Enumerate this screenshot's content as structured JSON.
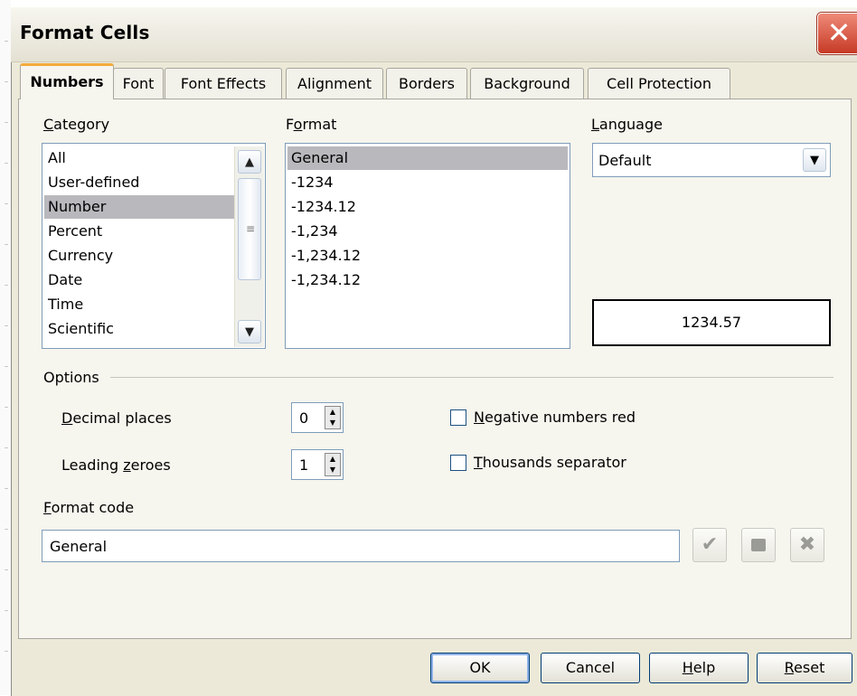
{
  "window": {
    "title": "Format Cells",
    "close_glyph": "✕"
  },
  "tabs": [
    {
      "label": "Numbers",
      "active": true
    },
    {
      "label": "Font"
    },
    {
      "label": "Font Effects"
    },
    {
      "label": "Alignment"
    },
    {
      "label": "Borders"
    },
    {
      "label": "Background"
    },
    {
      "label": "Cell Protection"
    }
  ],
  "category": {
    "label_first": "C",
    "label_rest": "ategory",
    "items": [
      "All",
      "User-defined",
      "Number",
      "Percent",
      "Currency",
      "Date",
      "Time",
      "Scientific"
    ],
    "selected": "Number"
  },
  "format": {
    "label_pre": "F",
    "label_u": "o",
    "label_post": "rmat",
    "items": [
      "General",
      "-1234",
      "-1234.12",
      "-1,234",
      "-1,234.12",
      "-1,234.12"
    ],
    "selected": "General"
  },
  "language": {
    "label_first": "L",
    "label_rest": "anguage",
    "value": "Default"
  },
  "preview": {
    "value": "1234.57"
  },
  "options": {
    "label": "Options",
    "decimal_places": {
      "label_first": "D",
      "label_rest": "ecimal places",
      "value": "0"
    },
    "leading_zeroes": {
      "label_pre": "Leading ",
      "label_u": "z",
      "label_post": "eroes",
      "value": "1"
    },
    "negative_red": {
      "label_first": "N",
      "label_rest": "egative numbers red",
      "checked": false
    },
    "thousands_sep": {
      "label_first": "T",
      "label_rest": "housands separator",
      "checked": false
    }
  },
  "format_code": {
    "label_first": "F",
    "label_rest": "ormat code",
    "value": "General",
    "icons": [
      "checkmark-icon",
      "add-comment-icon",
      "delete-icon"
    ]
  },
  "buttons": {
    "ok": "OK",
    "cancel": "Cancel",
    "help_first": "H",
    "help_rest": "elp",
    "reset_first": "R",
    "reset_rest": "eset"
  },
  "colors": {
    "tab_accent": "#f3ab3c",
    "selection": "#b9b9bd",
    "dialog_bg": "#ece9d8",
    "close_red": "#c63a25"
  }
}
